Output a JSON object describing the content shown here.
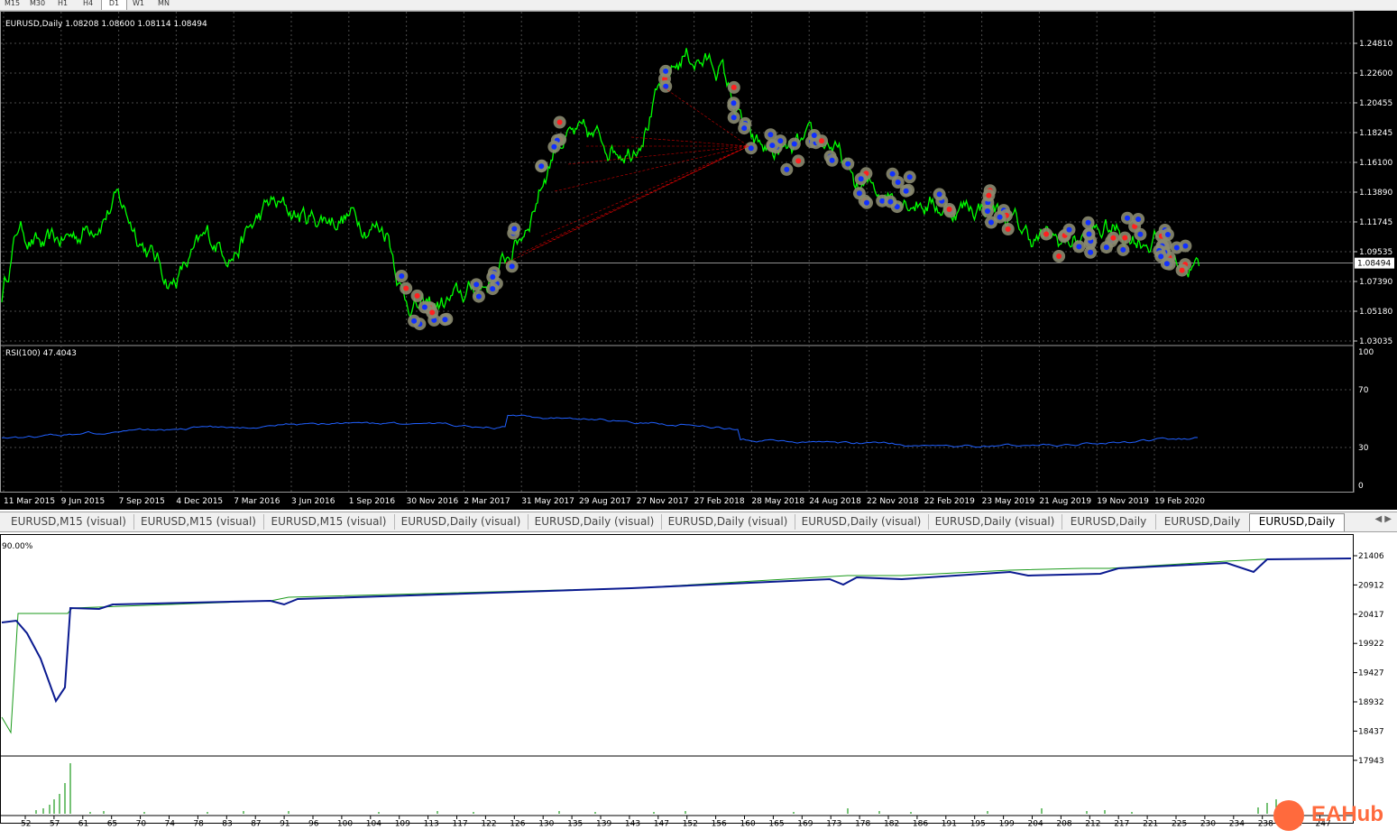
{
  "toolbar": {
    "timeframes": [
      "M15",
      "M30",
      "H1",
      "H4",
      "D1",
      "W1",
      "MN"
    ],
    "active": "D1"
  },
  "main_chart": {
    "info": "EURUSD,Daily  1.08208 1.08600 1.08114 1.08494",
    "current_price": "1.08494",
    "price_scale": [
      "1.24810",
      "1.22600",
      "1.20455",
      "1.18245",
      "1.16100",
      "1.13890",
      "1.11745",
      "1.09535",
      "1.07390",
      "1.05180",
      "1.03035"
    ],
    "colors": {
      "background": "#000000",
      "price_line": "#00ff00",
      "grid": "#4a4a4a",
      "buy_marker": "#1030ff",
      "sell_marker": "#ff2020",
      "marker_halo": "#8a8a70",
      "link_line": "#ff0000"
    }
  },
  "rsi_panel": {
    "info": "RSI(100) 47.4043",
    "scale": [
      "100",
      "70",
      "30",
      "0"
    ],
    "color": "#2060ff"
  },
  "date_axis": [
    "11 Mar 2015",
    "9 Jun 2015",
    "7 Sep 2015",
    "4 Dec 2015",
    "7 Mar 2016",
    "3 Jun 2016",
    "1 Sep 2016",
    "30 Nov 2016",
    "2 Mar 2017",
    "31 May 2017",
    "29 Aug 2017",
    "27 Nov 2017",
    "27 Feb 2018",
    "28 May 2018",
    "24 Aug 2018",
    "22 Nov 2018",
    "22 Feb 2019",
    "23 May 2019",
    "21 Aug 2019",
    "19 Nov 2019",
    "19 Feb 2020"
  ],
  "tabs": [
    {
      "label": "EURUSD,M15 (visual)",
      "active": false
    },
    {
      "label": "EURUSD,M15 (visual)",
      "active": false
    },
    {
      "label": "EURUSD,M15 (visual)",
      "active": false
    },
    {
      "label": "EURUSD,Daily (visual)",
      "active": false
    },
    {
      "label": "EURUSD,Daily (visual)",
      "active": false
    },
    {
      "label": "EURUSD,Daily (visual)",
      "active": false
    },
    {
      "label": "EURUSD,Daily (visual)",
      "active": false
    },
    {
      "label": "EURUSD,Daily (visual)",
      "active": false
    },
    {
      "label": "EURUSD,Daily",
      "active": false
    },
    {
      "label": "EURUSD,Daily",
      "active": false
    },
    {
      "label": "EURUSD,Daily",
      "active": true
    }
  ],
  "report": {
    "percent_label": "90.00%",
    "scale": [
      "21406",
      "20912",
      "20417",
      "19922",
      "19427",
      "18932",
      "18437",
      "17943"
    ],
    "x_axis": [
      "52",
      "57",
      "61",
      "65",
      "70",
      "74",
      "78",
      "83",
      "87",
      "91",
      "96",
      "100",
      "104",
      "109",
      "113",
      "117",
      "122",
      "126",
      "130",
      "135",
      "139",
      "143",
      "147",
      "152",
      "156",
      "160",
      "165",
      "169",
      "173",
      "178",
      "182",
      "186",
      "191",
      "195",
      "199",
      "204",
      "208",
      "212",
      "217",
      "221",
      "225",
      "230",
      "234",
      "238",
      "243",
      "247"
    ],
    "colors": {
      "balance": "#1a9a1a",
      "equity": "#0a1a90",
      "volume": "#1a9a1a"
    }
  },
  "watermark": {
    "text": "EAHub",
    "color": "#ff6a3d"
  }
}
